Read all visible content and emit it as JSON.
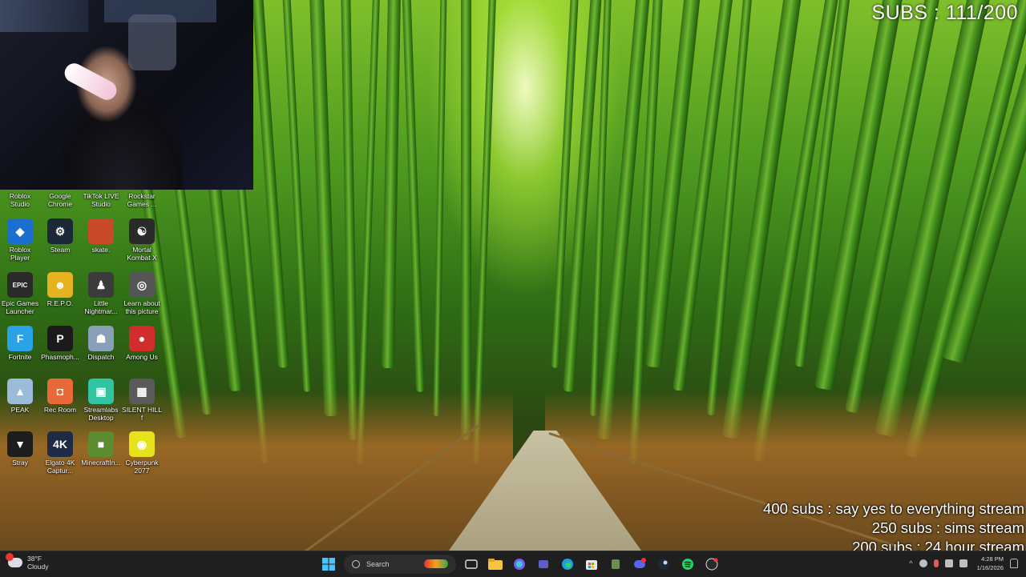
{
  "overlay": {
    "subs_counter": "SUBS : 111/200",
    "goals": [
      "400 subs :  say yes to everything stream",
      "250 subs : sims stream",
      "200 subs : 24 hour stream"
    ]
  },
  "desktop_icons": [
    {
      "label": "Roblox Studio",
      "icon": "roblox-studio-icon",
      "color": "#3a8bd8"
    },
    {
      "label": "Google Chrome",
      "icon": "chrome-icon",
      "color": "#4285f4"
    },
    {
      "label": "TikTok LIVE Studio",
      "icon": "tiktok-icon",
      "color": "#111111"
    },
    {
      "label": "Rockstar Games ...",
      "icon": "rockstar-icon",
      "color": "#f2a900"
    },
    {
      "label": "Roblox Player",
      "icon": "roblox-player-icon",
      "color": "#1a6fd1"
    },
    {
      "label": "Steam",
      "icon": "steam-icon",
      "color": "#1b2838"
    },
    {
      "label": "skate.",
      "icon": "skate-icon",
      "color": "#c94a2a"
    },
    {
      "label": "Mortal Kombat X",
      "icon": "mortal-kombat-icon",
      "color": "#2a2a2a"
    },
    {
      "label": "Epic Games Launcher",
      "icon": "epic-games-icon",
      "color": "#2a2a2a"
    },
    {
      "label": "R.E.P.O.",
      "icon": "repo-icon",
      "color": "#e7b21f"
    },
    {
      "label": "Little Nightmar...",
      "icon": "little-nightmares-icon",
      "color": "#3b3b3b"
    },
    {
      "label": "Learn about this picture",
      "icon": "camera-icon",
      "color": "#555555"
    },
    {
      "label": "Fortnite",
      "icon": "fortnite-icon",
      "color": "#2aa3e6"
    },
    {
      "label": "Phasmoph...",
      "icon": "phasmophobia-icon",
      "color": "#1a1a1a"
    },
    {
      "label": "Dispatch",
      "icon": "dispatch-icon",
      "color": "#8aa0b8"
    },
    {
      "label": "Among Us",
      "icon": "among-us-icon",
      "color": "#d22d2d"
    },
    {
      "label": "PEAK",
      "icon": "peak-icon",
      "color": "#9bbcd8"
    },
    {
      "label": "Rec Room",
      "icon": "rec-room-icon",
      "color": "#e86a3a"
    },
    {
      "label": "Streamlabs Desktop",
      "icon": "streamlabs-icon",
      "color": "#31c3a2"
    },
    {
      "label": "SILENT HILL f",
      "icon": "silent-hill-icon",
      "color": "#5a5a5a"
    },
    {
      "label": "Stray",
      "icon": "stray-icon",
      "color": "#1d1d1d"
    },
    {
      "label": "Elgato 4K Captur...",
      "icon": "elgato-icon",
      "color": "#1f2a44"
    },
    {
      "label": "MinecraftIn...",
      "icon": "minecraft-icon",
      "color": "#5b8c32"
    },
    {
      "label": "Cyberpunk 2077",
      "icon": "cyberpunk-icon",
      "color": "#e6e31c"
    }
  ],
  "icon_glyphs": {
    "roblox-studio-icon": "",
    "chrome-icon": "",
    "tiktok-icon": "",
    "rockstar-icon": "",
    "roblox-player-icon": "◆",
    "steam-icon": "⚙",
    "skate-icon": "",
    "mortal-kombat-icon": "☯",
    "epic-games-icon": "EPIC",
    "repo-icon": "☻",
    "little-nightmares-icon": "♟",
    "camera-icon": "◎",
    "fortnite-icon": "F",
    "phasmophobia-icon": "P",
    "dispatch-icon": "☗",
    "among-us-icon": "●",
    "peak-icon": "▲",
    "rec-room-icon": "◘",
    "streamlabs-icon": "▣",
    "silent-hill-icon": "▦",
    "stray-icon": "▼",
    "elgato-icon": "4K",
    "minecraft-icon": "■",
    "cyberpunk-icon": "◉"
  },
  "taskbar": {
    "weather_temp": "38°F",
    "weather_desc": "Cloudy",
    "search_label": "Search",
    "time": "4:28 PM",
    "date": "1/16/2026"
  }
}
